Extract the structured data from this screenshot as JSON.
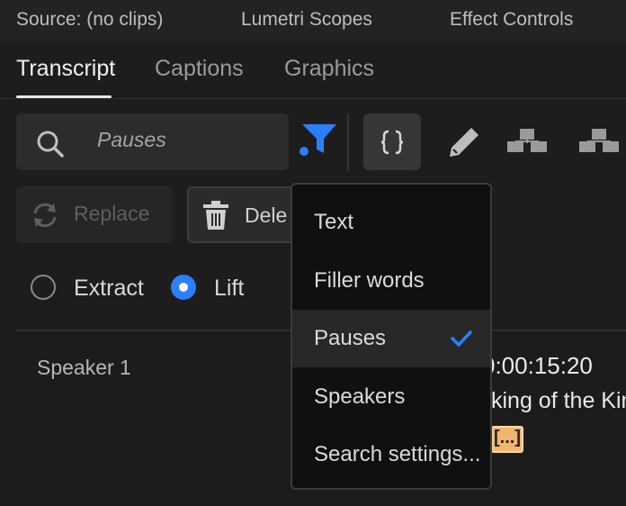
{
  "panel_tabs": [
    "Source: (no clips)",
    "Lumetri Scopes",
    "Effect Controls"
  ],
  "sub_tabs": [
    "Transcript",
    "Captions",
    "Graphics"
  ],
  "search": {
    "value": "Pauses"
  },
  "buttons": {
    "replace": "Replace",
    "delete": "Dele"
  },
  "radios": {
    "extract": "Extract",
    "lift": "Lift"
  },
  "transcript": {
    "speaker": "Speaker 1",
    "timecode": "0:00:15:20",
    "text": "king of the Kin",
    "pause_marker": "[...]"
  },
  "dropdown": {
    "items": [
      "Text",
      "Filler words",
      "Pauses",
      "Speakers",
      "Search settings..."
    ],
    "selected": "Pauses"
  },
  "colors": {
    "accent": "#2d7ff9",
    "pause_highlight": "#f0b66f"
  },
  "icons": [
    "search-icon",
    "filter-icon",
    "code-icon",
    "pencil-icon",
    "align-icon",
    "distribute-icon",
    "refresh-icon",
    "trash-icon",
    "checkmark-icon"
  ]
}
